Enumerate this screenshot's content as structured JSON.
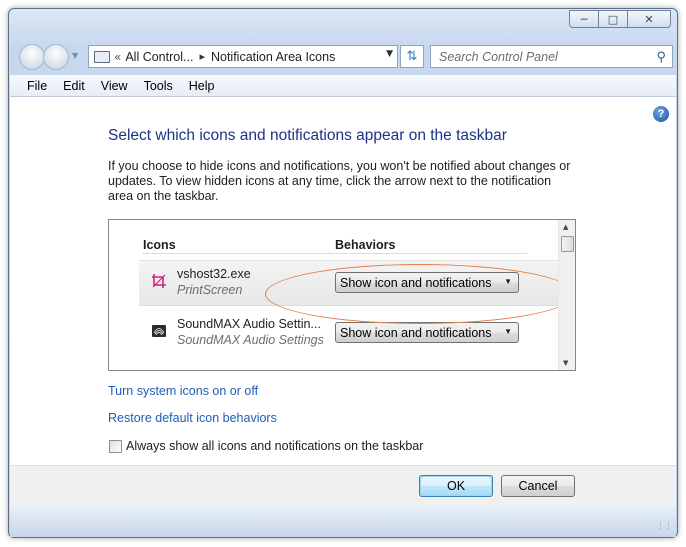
{
  "window": {
    "caption_buttons": {
      "minimize_icon": "minimize-icon",
      "maximize_icon": "maximize-icon",
      "close_icon": "close-icon"
    }
  },
  "navbar": {
    "breadcrumb_prefix": "«",
    "breadcrumb_parent": "All Control...",
    "breadcrumb_arrow": "▸",
    "breadcrumb_current": "Notification Area Icons",
    "search_placeholder": "Search Control Panel"
  },
  "menubar": {
    "items": [
      "File",
      "Edit",
      "View",
      "Tools",
      "Help"
    ]
  },
  "content": {
    "heading": "Select which icons and notifications appear on the taskbar",
    "description": "If you choose to hide icons and notifications, you won't be notified about changes or updates. To view hidden icons at any time, click the arrow next to the notification area on the taskbar.",
    "list": {
      "col_icons": "Icons",
      "col_behaviors": "Behaviors",
      "rows": [
        {
          "title": "vshost32.exe",
          "subtitle": "PrintScreen",
          "behavior": "Show icon and notifications",
          "icon": "crop-icon",
          "selected": true
        },
        {
          "title": "SoundMAX Audio Settin...",
          "subtitle": "SoundMAX Audio Settings",
          "behavior": "Show icon and notifications",
          "icon": "audio-icon",
          "selected": false
        }
      ]
    },
    "link_system_icons": "Turn system icons on or off",
    "link_restore": "Restore default icon behaviors",
    "checkbox_label": "Always show all icons and notifications on the taskbar",
    "checkbox_checked": false
  },
  "footer": {
    "ok_label": "OK",
    "cancel_label": "Cancel"
  },
  "colors": {
    "heading": "#1e3287",
    "link": "#1e5fb4",
    "highlight": "#e5804a"
  }
}
